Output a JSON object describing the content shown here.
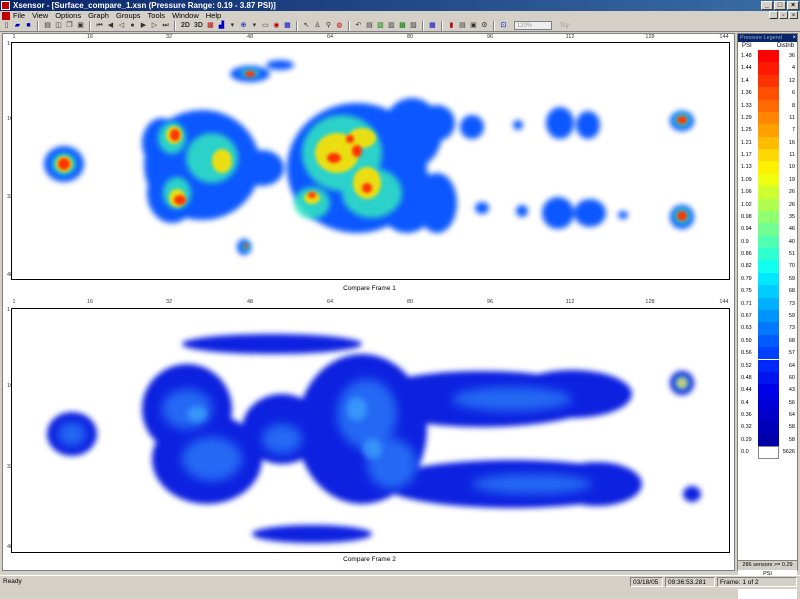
{
  "window": {
    "title": "Xsensor - [Surface_compare_1.xsn (Pressure Range: 0.19 - 3.87 PSI)]"
  },
  "menu": [
    "File",
    "View",
    "Options",
    "Graph",
    "Groups",
    "Tools",
    "Window",
    "Help"
  ],
  "toolbar": {
    "btn_2d": "2D",
    "btn_3d": "3D",
    "zoom_value": "120%",
    "disabled_label": "Tcy"
  },
  "panels": {
    "x_ticks": [
      "1",
      "16",
      "32",
      "48",
      "64",
      "80",
      "96",
      "112",
      "128",
      "144"
    ],
    "top": {
      "caption": "Compare Frame 1",
      "y_ticks": [
        "1",
        "16",
        "32",
        "48"
      ]
    },
    "bottom": {
      "caption": "Compare Frame 2",
      "y_ticks": [
        "1",
        "16",
        "32",
        "48"
      ]
    }
  },
  "legend": {
    "title": "Pressure Legend",
    "psi_header": "PSI",
    "dist_header": "Distrib",
    "rows": [
      {
        "psi": "1.48",
        "count": "36",
        "color": "#ff0000"
      },
      {
        "psi": "1.44",
        "count": "4",
        "color": "#ff1a00"
      },
      {
        "psi": "1.4",
        "count": "12",
        "color": "#ff3300"
      },
      {
        "psi": "1.36",
        "count": "6",
        "color": "#ff5000"
      },
      {
        "psi": "1.33",
        "count": "8",
        "color": "#ff6a00"
      },
      {
        "psi": "1.29",
        "count": "11",
        "color": "#ff8600"
      },
      {
        "psi": "1.25",
        "count": "7",
        "color": "#ffa000"
      },
      {
        "psi": "1.21",
        "count": "16",
        "color": "#ffbb00"
      },
      {
        "psi": "1.17",
        "count": "11",
        "color": "#ffd800"
      },
      {
        "psi": "1.13",
        "count": "10",
        "color": "#fff000"
      },
      {
        "psi": "1.09",
        "count": "19",
        "color": "#f0ff10"
      },
      {
        "psi": "1.06",
        "count": "26",
        "color": "#d0ff30"
      },
      {
        "psi": "1.02",
        "count": "26",
        "color": "#b0ff50"
      },
      {
        "psi": "0.98",
        "count": "35",
        "color": "#90ff70"
      },
      {
        "psi": "0.94",
        "count": "46",
        "color": "#70ff90"
      },
      {
        "psi": "0.9",
        "count": "40",
        "color": "#50ffb0"
      },
      {
        "psi": "0.86",
        "count": "51",
        "color": "#30ffd0"
      },
      {
        "psi": "0.82",
        "count": "70",
        "color": "#10ffee"
      },
      {
        "psi": "0.79",
        "count": "59",
        "color": "#00e8ff"
      },
      {
        "psi": "0.75",
        "count": "68",
        "color": "#00ccff"
      },
      {
        "psi": "0.71",
        "count": "73",
        "color": "#00b0ff"
      },
      {
        "psi": "0.67",
        "count": "59",
        "color": "#0094ff"
      },
      {
        "psi": "0.63",
        "count": "73",
        "color": "#0078ff"
      },
      {
        "psi": "0.59",
        "count": "68",
        "color": "#005cff"
      },
      {
        "psi": "0.56",
        "count": "57",
        "color": "#0040ff"
      },
      {
        "psi": "0.52",
        "count": "64",
        "color": "#0028f8"
      },
      {
        "psi": "0.48",
        "count": "60",
        "color": "#0014f0"
      },
      {
        "psi": "0.44",
        "count": "43",
        "color": "#0000e8"
      },
      {
        "psi": "0.4",
        "count": "56",
        "color": "#0000d8"
      },
      {
        "psi": "0.36",
        "count": "64",
        "color": "#0000c8"
      },
      {
        "psi": "0.32",
        "count": "58",
        "color": "#0000b8"
      },
      {
        "psi": "0.29",
        "count": "58",
        "color": "#0000a8"
      },
      {
        "psi": "0.0",
        "count": "5626",
        "color": "#ffffff"
      }
    ],
    "footer": "286 sensors >= 0.29 PSI"
  },
  "status": {
    "ready": "Ready",
    "date": "03/18/05",
    "time": "09:36:53.281",
    "frame": "Frame: 1 of 2"
  }
}
